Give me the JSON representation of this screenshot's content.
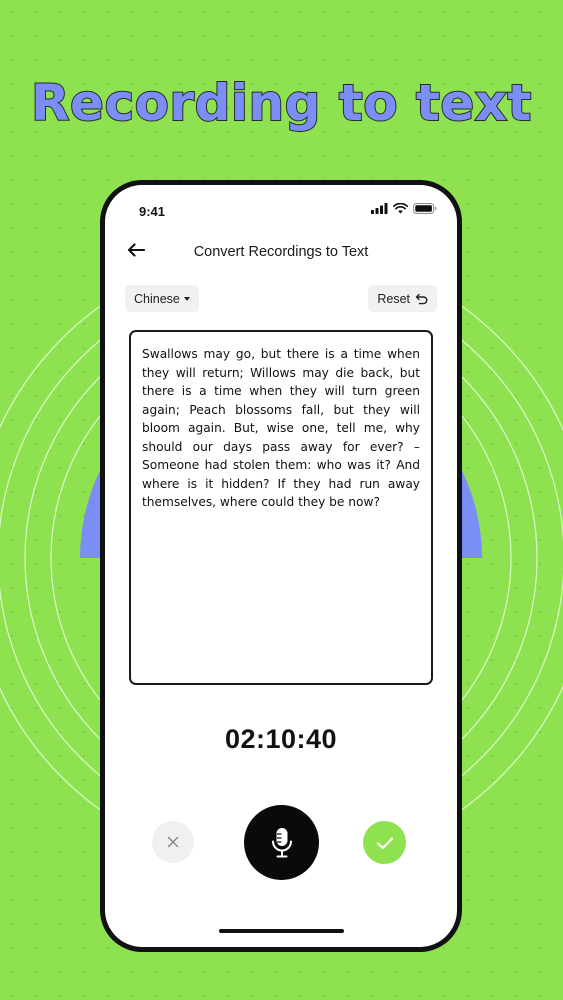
{
  "promo": {
    "headline": "Recording to text"
  },
  "status_bar": {
    "time": "9:41",
    "icons": [
      "signal-icon",
      "wifi-icon",
      "battery-icon"
    ]
  },
  "nav": {
    "back_icon": "back-arrow-icon",
    "title": "Convert Recordings to Text"
  },
  "toolbar": {
    "language": "Chinese",
    "reset_label": "Reset",
    "reset_icon": "undo-icon"
  },
  "transcript": {
    "text": "Swallows may go, but there is a time when they will return; Willows may die back, but there is a time when they will turn green again; Peach blossoms fall, but they will bloom again. But, wise one, tell me, why should our days pass away for ever? – Someone had stolen them: who was it? And where is it hidden? If they had run away themselves, where could they be now?"
  },
  "recorder": {
    "elapsed": "02:10:40",
    "cancel_icon": "close-icon",
    "mic_icon": "microphone-icon",
    "confirm_icon": "check-icon"
  },
  "colors": {
    "background": "#8fe24f",
    "headline": "#7b8ef5",
    "accent_blue": "#7b8ef5",
    "confirm": "#8fe24f",
    "mic_button": "#0a0a0a"
  }
}
